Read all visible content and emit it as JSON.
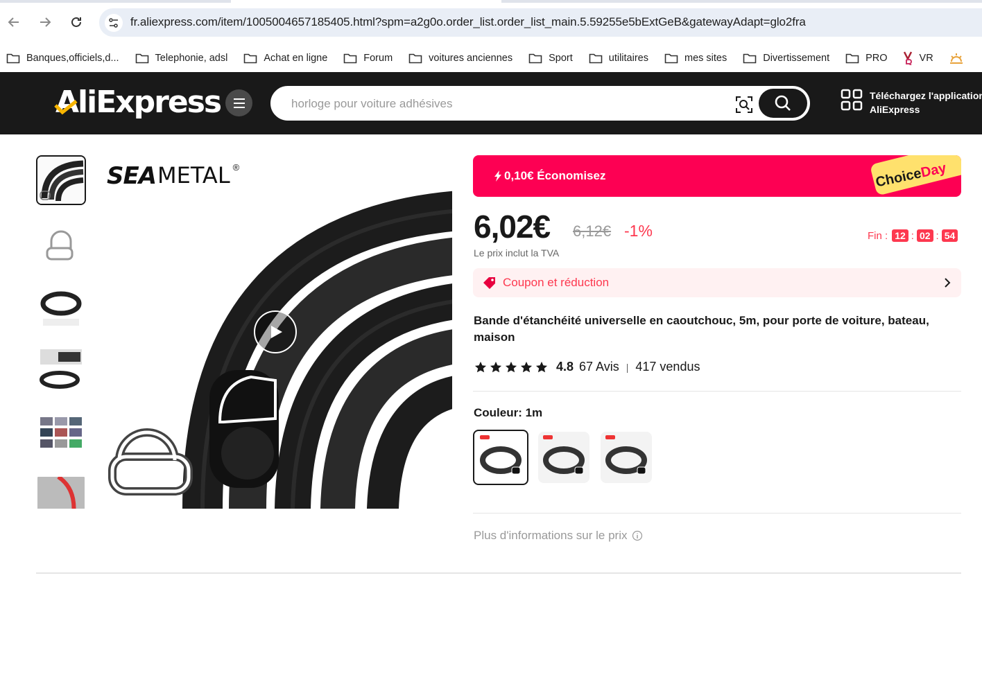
{
  "browser": {
    "url": "fr.aliexpress.com/item/1005004657185405.html?spm=a2g0o.order_list.order_list_main.5.59255e5bExtGeB&gatewayAdapt=glo2fra",
    "bookmarks": [
      "Banques,officiels,d...",
      "Telephonie, adsl",
      "Achat en ligne",
      "Forum",
      "voitures anciennes",
      "Sport",
      "utilitaires",
      "mes sites",
      "Divertissement",
      "PRO",
      "VR"
    ]
  },
  "header": {
    "logo": "AliExpress",
    "search_placeholder": "horloge pour voiture adhésives",
    "app_line1": "Téléchargez l'application",
    "app_line2": "AliExpress"
  },
  "gallery": {
    "brand": "SEAMETAL",
    "brand_a": "SEA",
    "brand_b": "METAL",
    "registered": "®"
  },
  "product": {
    "promo_save": "0,10€ Économisez",
    "choice_a": "Choice",
    "choice_b": "Day",
    "price": "6,02€",
    "old_price": "6,12€",
    "discount": "-1%",
    "timer_label": "Fin :",
    "timer_h": "12",
    "timer_m": "02",
    "timer_s": "54",
    "vat": "Le prix inclut la TVA",
    "coupon": "Coupon et réduction",
    "title": "Bande d'étanchéité universelle en caoutchouc, 5m, pour porte de voiture, bateau, maison",
    "rating": 4.8,
    "rating_text": "4.8",
    "reviews": "67 Avis",
    "sold": "417 vendus",
    "color_label": "Couleur: 1m",
    "more_info": "Plus d'informations sur le prix"
  },
  "colors": {
    "accent": "#fd0053",
    "price_red": "#fd384f",
    "header_bg": "#191919"
  }
}
